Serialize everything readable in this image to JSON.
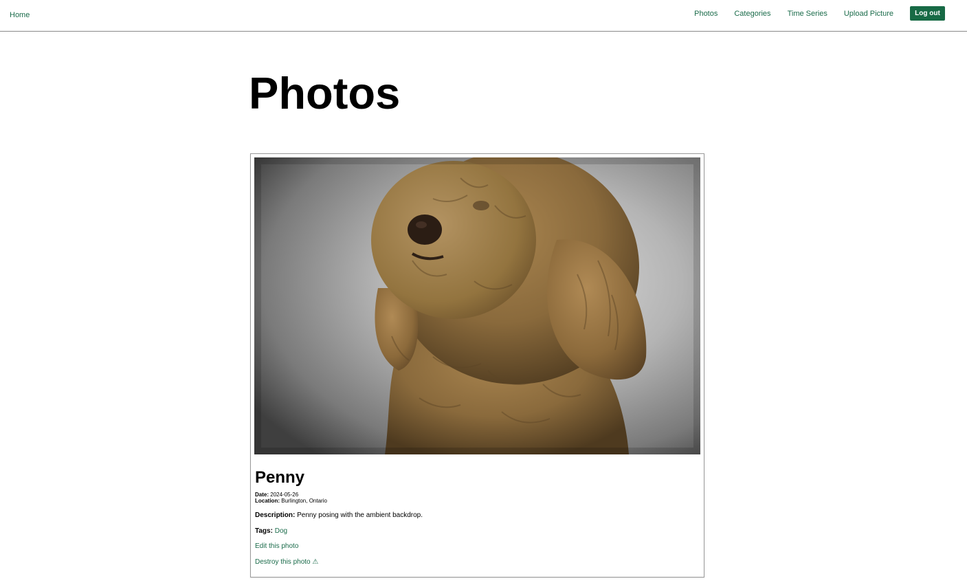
{
  "nav": {
    "home": "Home",
    "links": [
      "Photos",
      "Categories",
      "Time Series",
      "Upload Picture"
    ],
    "logout": "Log out"
  },
  "page": {
    "title": "Photos"
  },
  "photo": {
    "name": "Penny",
    "date_label": "Date:",
    "date": "2024-05-26",
    "location_label": "Location:",
    "location": "Burlington, Ontario",
    "description_label": "Description:",
    "description": "Penny posing with the ambient backdrop.",
    "tags_label": "Tags:",
    "tag": "Dog",
    "edit": "Edit this photo",
    "destroy": "Destroy this photo ⚠",
    "image_subject": "dog-photo"
  },
  "colors": {
    "link": "#1a6b4a",
    "button": "#176a45"
  }
}
